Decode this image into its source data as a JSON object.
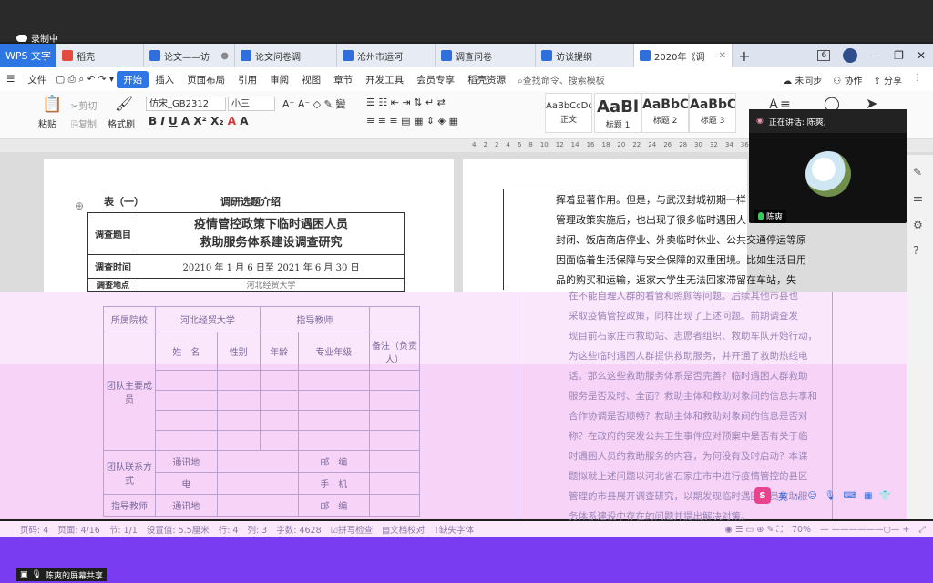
{
  "recording": {
    "label": "录制中"
  },
  "tabs": {
    "wps": "WPS 文字",
    "docs": [
      {
        "label": "稻壳",
        "icon": "r"
      },
      {
        "label": "论文——访",
        "icon": "w"
      },
      {
        "label": "论文问卷调",
        "icon": "w"
      },
      {
        "label": "沧州市运河",
        "icon": "w"
      },
      {
        "label": "调查问卷",
        "icon": "w"
      },
      {
        "label": "访谈提纲",
        "icon": "w"
      },
      {
        "label": "2020年《调",
        "icon": "w",
        "active": true
      }
    ],
    "page_indicator": "6"
  },
  "menu": {
    "file": "文件",
    "items": [
      "开始",
      "插入",
      "页面布局",
      "引用",
      "审阅",
      "视图",
      "章节",
      "开发工具",
      "会员专享",
      "稻壳资源"
    ],
    "search_placeholder": "查找命令、搜索模板",
    "unsynced": "未同步",
    "collaborate": "协作",
    "share": "分享"
  },
  "ribbon": {
    "paste": "粘贴",
    "cut": "剪切",
    "copy": "复制",
    "format_painter": "格式刷",
    "font_name": "仿宋_GB2312",
    "font_size": "小三",
    "styles": [
      {
        "preview": "AaBbCcDd",
        "name": "正文"
      },
      {
        "preview": "AaBl",
        "name": "标题 1"
      },
      {
        "preview": "AaBbC",
        "name": "标题 2"
      },
      {
        "preview": "AaBbC",
        "name": "标题 3"
      }
    ]
  },
  "ruler": {
    "ticks": [
      "4",
      "2",
      "2",
      "4",
      "6",
      "8",
      "10",
      "12",
      "14",
      "16",
      "18",
      "20",
      "22",
      "24",
      "26",
      "28",
      "30",
      "32",
      "34",
      "36",
      "38",
      "40",
      "42"
    ]
  },
  "document": {
    "table_caption": "表（一）",
    "table_title": "调研选题介绍",
    "rows": [
      {
        "label": "调查题目",
        "value_line1": "疫情管控政策下临时遇困人员",
        "value_line2": "救助服务体系建设调查研究"
      },
      {
        "label": "调查时间",
        "value": "20210 年 1 月 6 日至 2021  年 6 月 30 日"
      },
      {
        "label": "调查地点",
        "value": "河北经贸大学"
      }
    ],
    "right_text": [
      "挥着显著作用。但是，与武汉封城初期一样",
      "管理政策实施后，也出现了很多临时遇困人",
      "封闭、饭店商店停业、外卖临时休业、公共交通停运等原",
      "因面临着生活保障与安全保障的双重困境。比如生活日用",
      "品的购买和运输，返家大学生无法回家滞留在车站，失"
    ]
  },
  "pink_doc": {
    "school_label": "所属院校",
    "school_value": "河北经贸大学",
    "advisor_label": "指导教师",
    "team_label": "团队主要成员",
    "headers": [
      "姓　名",
      "性别",
      "年龄",
      "专业年级",
      "备注（负责人）"
    ],
    "contact_label": "团队联系方式",
    "contact_rows": [
      {
        "k": "通讯地",
        "k2": "邮　编"
      },
      {
        "k": "电",
        "k2": "手　机"
      }
    ],
    "advisor_contact_label": "指导教师",
    "advisor_rows": [
      {
        "k": "通讯地",
        "k2": "邮　编"
      }
    ],
    "right_text": [
      "在不能自理人群的看管和照顾等问题。后续其他市县也",
      "采取疫情管控政策，同样出现了上述问题。前期调查发",
      "现目前石家庄市救助站、志愿者组织、救助车队开始行动，",
      "为这些临时遇困人群提供救助服务，并开通了救助热线电",
      "话。那么这些救助服务体系是否完善？临时遇困人群救助",
      "服务是否及时、全面？救助主体和救助对象间的信息共享和",
      "合作协调是否顺畅？救助主体和救助对象间的信息是否对",
      "称？在政府的突发公共卫生事件应对预案中是否有关于临",
      "时遇困人员的救助服务的内容，为何没有及时启动？本课",
      "题拟就上述问题以河北省石家庄市中进行疫情管控的县区",
      "管理的市县展开调查研究，以期发现临时遇困人员救助服",
      "务体系建设中存在的问题并提出解决对策。"
    ]
  },
  "status": {
    "page_num": "页码: 4",
    "page_of": "页面: 4/16",
    "section": "节: 1/1",
    "setting": "设置值: 5.5厘米",
    "row": "行: 4",
    "col": "列: 3",
    "words": "字数: 4628",
    "spell": "拼写检查",
    "proof": "文档校对",
    "missing_font": "缺失字体",
    "zoom": "70%"
  },
  "call": {
    "speaking": "正在讲话: 陈爽;",
    "name": "陈爽"
  },
  "ime": {
    "lang": "英"
  },
  "share": {
    "label": "陈爽的屏幕共享"
  },
  "colors": {
    "accent": "#2e76e4",
    "purple_band": "#7a3cf0",
    "pink": "#fbe7fb"
  }
}
